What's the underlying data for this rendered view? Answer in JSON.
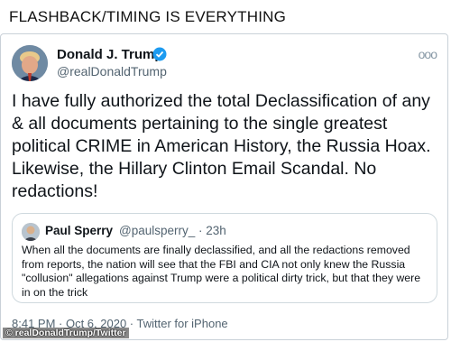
{
  "caption": "FLASHBACK/TIMING IS EVERYTHING",
  "tweet": {
    "name": "Donald J. Trump",
    "handle": "@realDonaldTrump",
    "text": "I have fully authorized the total Declassification of any & all documents pertaining to the single greatest political CRIME in American History, the Russia Hoax. Likewise, the Hillary Clinton Email Scandal. No redactions!",
    "timestamp": "8:41 PM · Oct 6, 2020 · Twitter for iPhone",
    "verified_color": "#1d9bf0"
  },
  "quote": {
    "name": "Paul Sperry",
    "meta": "@paulsperry_ · 23h",
    "text": "When all the documents are finally declassified, and all the redactions removed from reports, the nation will see that the FBI and CIA not only knew the Russia \"collusion\" allegations against Trump were a political dirty trick, but that they were in on the trick"
  },
  "watermark": "© realDonaldTrump/Twitter"
}
